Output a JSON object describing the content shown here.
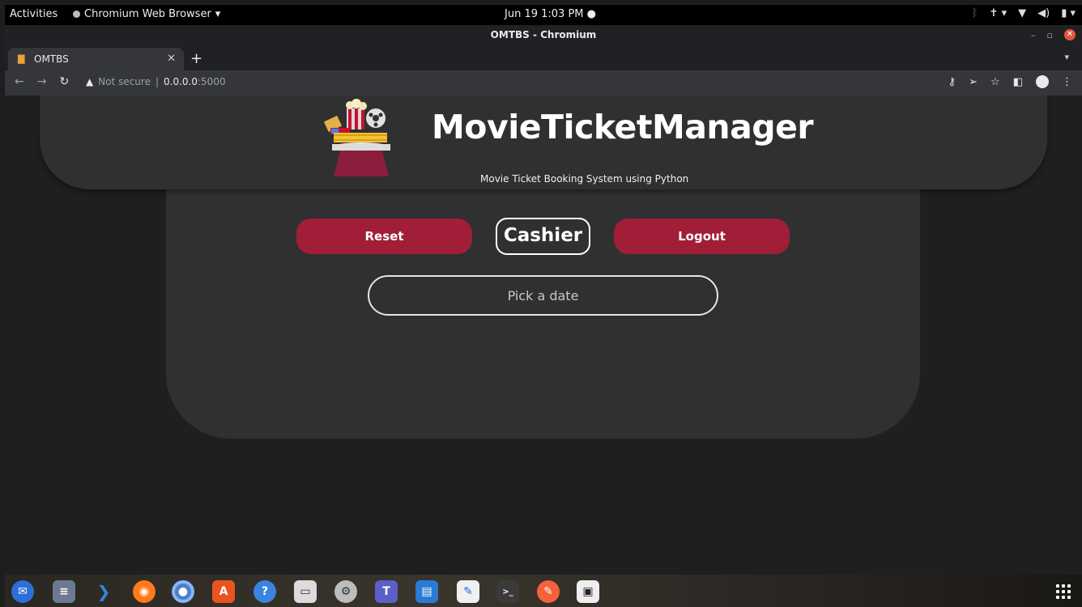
{
  "system_bar": {
    "activities": "Activities",
    "app_name": "Chromium Web Browser",
    "clock": "Jun 19  1:03 PM"
  },
  "window": {
    "title": "OMTBS - Chromium"
  },
  "tabs": [
    {
      "label": "OMTBS"
    }
  ],
  "toolbar": {
    "security_label": "Not secure",
    "url_host": "0.0.0.0",
    "url_port": ":5000"
  },
  "page": {
    "brand": "MovieTicketManager",
    "tagline": "Movie Ticket Booking System using Python",
    "reset_label": "Reset",
    "role_label": "Cashier",
    "logout_label": "Logout",
    "date_placeholder": "Pick a date",
    "accent_color": "#a01e38"
  },
  "dock": {
    "apps": [
      "thunderbird-icon",
      "text-editor-icon",
      "vscode-icon",
      "firefox-icon",
      "chromium-icon",
      "software-center-icon",
      "help-icon",
      "files-icon",
      "settings-icon",
      "teams-icon",
      "libreoffice-writer-icon",
      "notes-icon",
      "terminal-icon",
      "pencil-app-icon",
      "media-player-icon"
    ]
  }
}
